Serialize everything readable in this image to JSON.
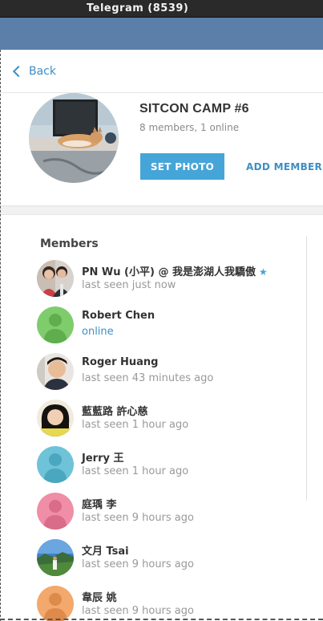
{
  "window": {
    "title": "Telegram (8539)"
  },
  "nav": {
    "back_label": "Back"
  },
  "group": {
    "title": "SITCON CAMP #6",
    "subtitle": "8 members, 1 online",
    "set_photo_label": "SET PHOTO",
    "add_members_label": "ADD MEMBERS"
  },
  "members": {
    "heading": "Members",
    "items": [
      {
        "name": "PN Wu (小平) @ 我是澎湖人我驕傲",
        "status": "last seen just now",
        "online": false,
        "starred": true,
        "avatar": "photo-couple"
      },
      {
        "name": "Robert Chen",
        "status": "online",
        "online": true,
        "starred": false,
        "avatar": "placeholder-green"
      },
      {
        "name": "Roger Huang",
        "status": "last seen 43 minutes ago",
        "online": false,
        "starred": false,
        "avatar": "photo-man"
      },
      {
        "name": "藍藍路 許心慈",
        "status": "last seen 1 hour ago",
        "online": false,
        "starred": false,
        "avatar": "photo-woman"
      },
      {
        "name": "Jerry 王",
        "status": "last seen 1 hour ago",
        "online": false,
        "starred": false,
        "avatar": "placeholder-cyan"
      },
      {
        "name": "庭瑀 李",
        "status": "last seen 9 hours ago",
        "online": false,
        "starred": false,
        "avatar": "placeholder-pink"
      },
      {
        "name": "文月 Tsai",
        "status": "last seen 9 hours ago",
        "online": false,
        "starred": false,
        "avatar": "photo-landscape"
      },
      {
        "name": "韋辰 姚",
        "status": "last seen 9 hours ago",
        "online": false,
        "starred": false,
        "avatar": "placeholder-orange"
      }
    ]
  },
  "colors": {
    "accent": "#3e8ec4",
    "button": "#45a5d8",
    "header": "#5b7fa8",
    "placeholder-green": "#7fcc6c",
    "placeholder-cyan": "#6ec3d8",
    "placeholder-pink": "#f08ea8",
    "placeholder-orange": "#f3a86c"
  }
}
